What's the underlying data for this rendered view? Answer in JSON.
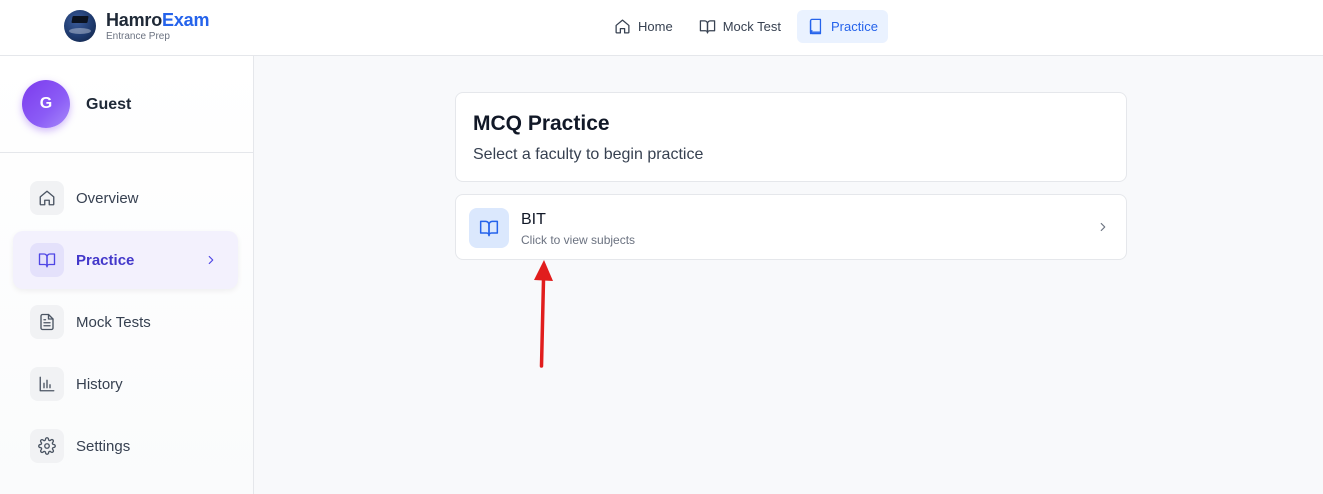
{
  "brand": {
    "name_part1": "Hamro",
    "name_part2": "Exam",
    "tagline": "Entrance Prep"
  },
  "topnav": {
    "items": [
      {
        "label": "Home",
        "icon": "home-icon",
        "active": false
      },
      {
        "label": "Mock Test",
        "icon": "book-open-icon",
        "active": false
      },
      {
        "label": "Practice",
        "icon": "book-icon",
        "active": true
      }
    ]
  },
  "user": {
    "initial": "G",
    "name": "Guest"
  },
  "sidebar": {
    "items": [
      {
        "label": "Overview",
        "icon": "home-icon",
        "active": false
      },
      {
        "label": "Practice",
        "icon": "book-open-icon",
        "active": true
      },
      {
        "label": "Mock Tests",
        "icon": "file-text-icon",
        "active": false
      },
      {
        "label": "History",
        "icon": "bar-chart-icon",
        "active": false
      },
      {
        "label": "Settings",
        "icon": "gear-icon",
        "active": false
      }
    ]
  },
  "main": {
    "title": "MCQ Practice",
    "subtitle": "Select a faculty to begin practice",
    "faculties": [
      {
        "name": "BIT",
        "hint": "Click to view subjects"
      }
    ]
  },
  "colors": {
    "accent": "#2563eb",
    "sidebar_active": "#4f46e5",
    "avatar": "#7c3aed",
    "annotation_arrow": "#e11d1d"
  }
}
